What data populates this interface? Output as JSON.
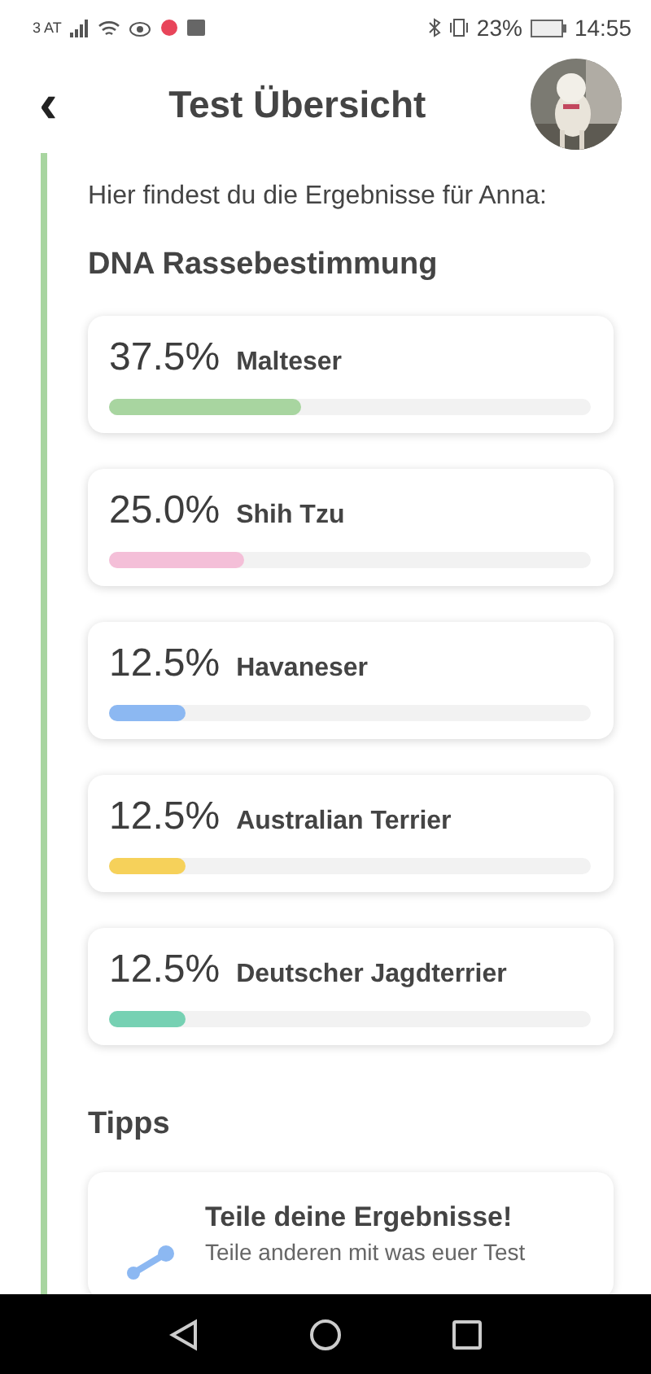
{
  "status_bar": {
    "carrier": "3 AT",
    "battery": "23%",
    "time": "14:55"
  },
  "header": {
    "back": "‹",
    "title": "Test Übersicht"
  },
  "intro": "Hier findest du die Ergebnisse für Anna:",
  "section_title": "DNA Rassebestimmung",
  "breeds": [
    {
      "percent": "37.5%",
      "name": "Malteser",
      "level": 0.4,
      "color": "#a8d5a0"
    },
    {
      "percent": "25.0%",
      "name": "Shih Tzu",
      "level": 0.28,
      "color": "#f4bfd8"
    },
    {
      "percent": "12.5%",
      "name": "Havaneser",
      "level": 0.16,
      "color": "#8cb8f2"
    },
    {
      "percent": "12.5%",
      "name": "Australian Terrier",
      "level": 0.16,
      "color": "#f6d15a"
    },
    {
      "percent": "12.5%",
      "name": "Deutscher Jagdterrier",
      "level": 0.16,
      "color": "#76d1b3"
    }
  ],
  "tips": {
    "title": "Tipps",
    "items": [
      {
        "title": "Teile deine Ergebnisse!",
        "text": "Teile anderen mit was euer Test"
      }
    ]
  }
}
